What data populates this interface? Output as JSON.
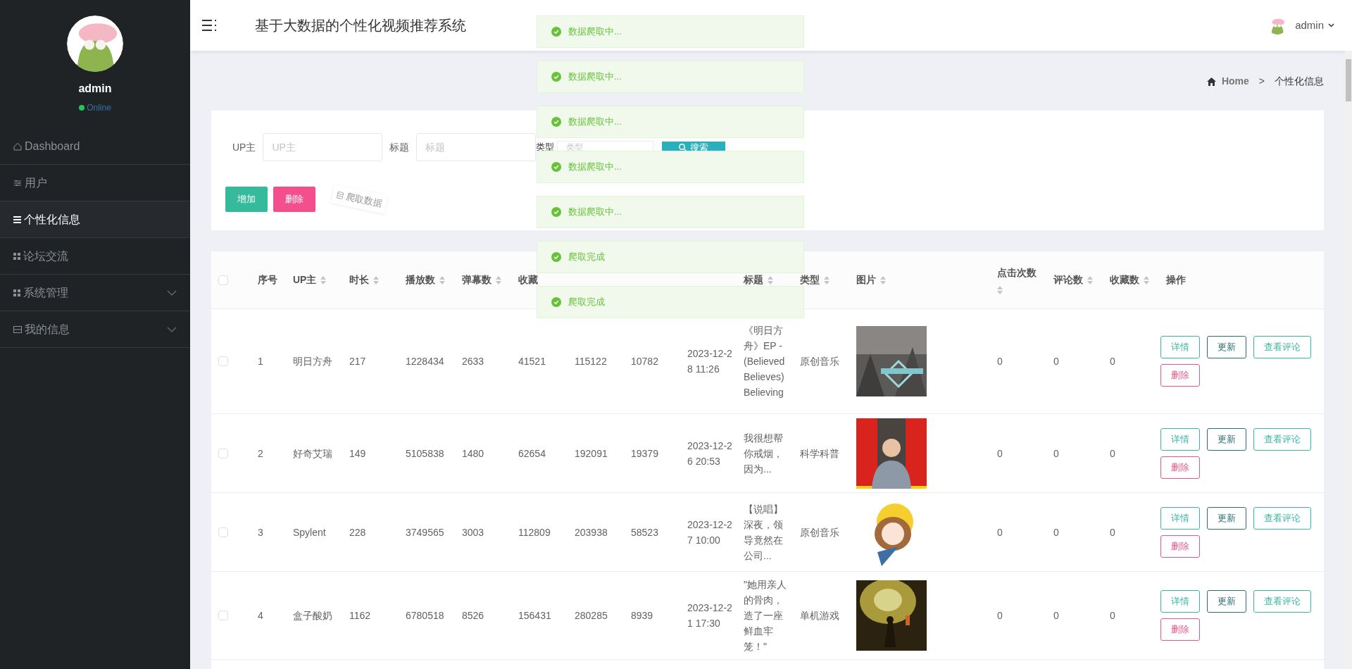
{
  "sidebar": {
    "user": {
      "name": "admin",
      "status": "Online"
    },
    "items": [
      {
        "label": "Dashboard",
        "selected": false,
        "expandable": false
      },
      {
        "label": "用户",
        "selected": false,
        "expandable": false
      },
      {
        "label": "个性化信息",
        "selected": true,
        "expandable": false
      },
      {
        "label": "论坛交流",
        "selected": false,
        "expandable": false
      },
      {
        "label": "系统管理",
        "selected": false,
        "expandable": true
      },
      {
        "label": "我的信息",
        "selected": false,
        "expandable": true
      }
    ]
  },
  "header": {
    "title": "基于大数据的个性化视频推荐系统",
    "user": "admin"
  },
  "breadcrumb": {
    "home": "Home",
    "separator": ">",
    "current": "个性化信息"
  },
  "search": {
    "fields": [
      {
        "label": "UP主",
        "placeholder": "UP主"
      },
      {
        "label": "标题",
        "placeholder": "标题"
      },
      {
        "label": "类型",
        "placeholder": "类型"
      }
    ],
    "button": "搜索"
  },
  "actions": [
    {
      "label": "增加",
      "kind": "add"
    },
    {
      "label": "删除",
      "kind": "delete"
    },
    {
      "label": "爬取数据",
      "kind": "crawl"
    }
  ],
  "toasts": [
    {
      "text": "数据爬取中...",
      "kind": "success"
    },
    {
      "text": "数据爬取中...",
      "kind": "success"
    },
    {
      "text": "数据爬取中...",
      "kind": "success"
    },
    {
      "text": "数据爬取中...",
      "kind": "success"
    },
    {
      "text": "数据爬取中...",
      "kind": "success"
    },
    {
      "text": "爬取完成",
      "kind": "success"
    },
    {
      "text": "爬取完成",
      "kind": "success"
    }
  ],
  "table": {
    "select_all_checked": false,
    "columns": [
      {
        "label": "序号",
        "sortable": false
      },
      {
        "label": "UP主",
        "sortable": true
      },
      {
        "label": "时长",
        "sortable": true
      },
      {
        "label": "播放数",
        "sortable": true
      },
      {
        "label": "弹幕数",
        "sortable": true
      },
      {
        "label": "收藏",
        "sortable": false
      },
      null,
      null,
      null,
      {
        "label": "标题",
        "sortable": true
      },
      {
        "label": "类型",
        "sortable": true
      },
      {
        "label": "图片",
        "sortable": true
      },
      {
        "label": "点击次数",
        "sortable": true
      },
      {
        "label": "评论数",
        "sortable": true
      },
      {
        "label": "收藏数",
        "sortable": true
      },
      {
        "label": "操作",
        "sortable": false
      }
    ],
    "rows": [
      {
        "checked": false,
        "cells": [
          "1",
          "明日方舟",
          "217",
          "1228434",
          "2633",
          "41521",
          "115122",
          "10782",
          "2023-12-28 11:26",
          "《明日方舟》EP - (Believed Believes) Believing",
          "原创音乐",
          {
            "kind": "picture"
          },
          "0",
          "0",
          "0"
        ],
        "actions": [
          {
            "label": "详情",
            "kind": "detail"
          },
          {
            "label": "更新",
            "kind": "update"
          },
          {
            "label": "查看评论",
            "kind": "comments"
          },
          {
            "label": "删除",
            "kind": "delete"
          }
        ]
      },
      {
        "checked": false,
        "cells": [
          "2",
          "好奇艾瑞",
          "149",
          "5105838",
          "1480",
          "62654",
          "192091",
          "19379",
          "2023-12-26 20:53",
          "我很想帮你戒烟，因为...",
          "科学科普",
          {
            "kind": "picture"
          },
          "0",
          "0",
          "0"
        ],
        "actions": [
          {
            "label": "详情",
            "kind": "detail"
          },
          {
            "label": "更新",
            "kind": "update"
          },
          {
            "label": "查看评论",
            "kind": "comments"
          },
          {
            "label": "删除",
            "kind": "delete"
          }
        ]
      },
      {
        "checked": false,
        "cells": [
          "3",
          "Spylent",
          "228",
          "3749565",
          "3003",
          "112809",
          "203938",
          "58523",
          "2023-12-27 10:00",
          "【说唱】深夜，领导竟然在公司...",
          "原创音乐",
          {
            "kind": "picture"
          },
          "0",
          "0",
          "0"
        ],
        "actions": [
          {
            "label": "详情",
            "kind": "detail"
          },
          {
            "label": "更新",
            "kind": "update"
          },
          {
            "label": "查看评论",
            "kind": "comments"
          },
          {
            "label": "删除",
            "kind": "delete"
          }
        ]
      },
      {
        "checked": false,
        "cells": [
          "4",
          "盒子酸奶",
          "1162",
          "6780518",
          "8526",
          "156431",
          "280285",
          "8939",
          "2023-12-21 17:30",
          "\"她用亲人的骨肉，造了一座鲜血牢笼！\"",
          "单机游戏",
          {
            "kind": "picture"
          },
          "0",
          "0",
          "0"
        ],
        "actions": [
          {
            "label": "详情",
            "kind": "detail"
          },
          {
            "label": "更新",
            "kind": "update"
          },
          {
            "label": "查看评论",
            "kind": "comments"
          },
          {
            "label": "删除",
            "kind": "delete"
          }
        ]
      }
    ]
  }
}
